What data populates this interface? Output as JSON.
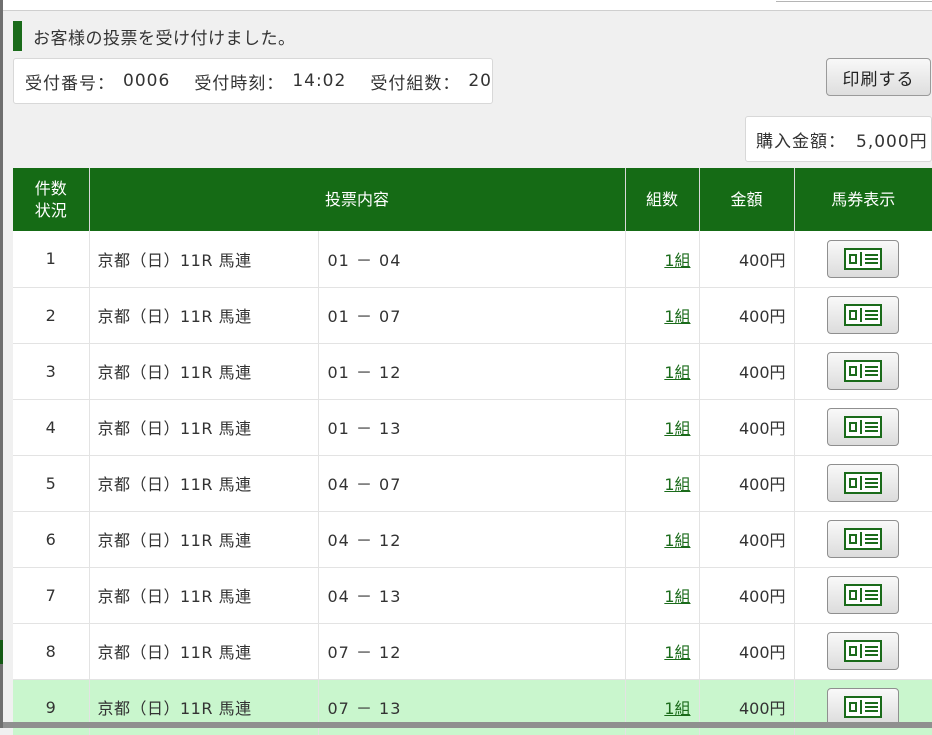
{
  "message": "お客様の投票を受け付けました。",
  "receipt": {
    "number_label": "受付番号：",
    "number": "0006",
    "time_label": "受付時刻：",
    "time": "14:02",
    "sets_label": "受付組数：",
    "sets": "20"
  },
  "print_button": "印刷する",
  "purchase": {
    "label": "購入金額：",
    "amount": "5,000円"
  },
  "table": {
    "headers": {
      "count_line1": "件数",
      "count_line2": "状況",
      "content": "投票内容",
      "sets": "組数",
      "amount": "金額",
      "ticket": "馬券表示"
    },
    "rows": [
      {
        "no": "1",
        "race": "京都（日）11R 馬連",
        "combo": "01 － 04",
        "sets": "1組",
        "amount": "400円"
      },
      {
        "no": "2",
        "race": "京都（日）11R 馬連",
        "combo": "01 － 07",
        "sets": "1組",
        "amount": "400円"
      },
      {
        "no": "3",
        "race": "京都（日）11R 馬連",
        "combo": "01 － 12",
        "sets": "1組",
        "amount": "400円"
      },
      {
        "no": "4",
        "race": "京都（日）11R 馬連",
        "combo": "01 － 13",
        "sets": "1組",
        "amount": "400円"
      },
      {
        "no": "5",
        "race": "京都（日）11R 馬連",
        "combo": "04 － 07",
        "sets": "1組",
        "amount": "400円"
      },
      {
        "no": "6",
        "race": "京都（日）11R 馬連",
        "combo": "04 － 12",
        "sets": "1組",
        "amount": "400円"
      },
      {
        "no": "7",
        "race": "京都（日）11R 馬連",
        "combo": "04 － 13",
        "sets": "1組",
        "amount": "400円"
      },
      {
        "no": "8",
        "race": "京都（日）11R 馬連",
        "combo": "07 － 12",
        "sets": "1組",
        "amount": "400円"
      },
      {
        "no": "9",
        "race": "京都（日）11R 馬連",
        "combo": "07 － 13",
        "sets": "1組",
        "amount": "400円",
        "highlighted": true
      }
    ]
  },
  "colors": {
    "header_green": "#156b15",
    "highlight_row": "#c9f6cd",
    "link_green": "#1a6b1a"
  },
  "icons": {
    "ticket": "ticket-view-icon"
  }
}
